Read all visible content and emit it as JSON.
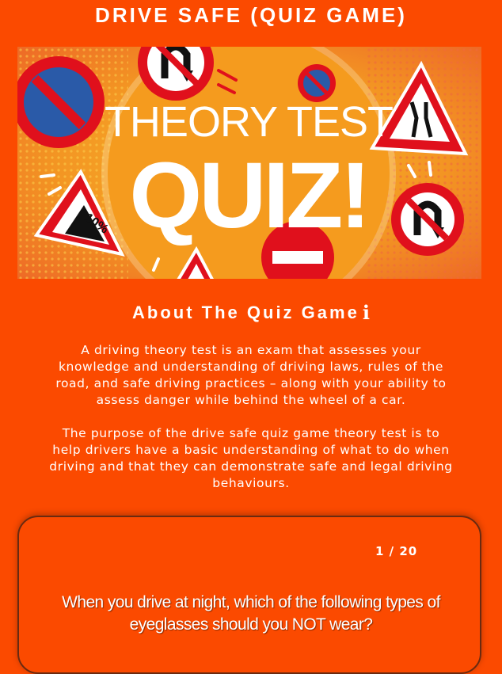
{
  "page": {
    "title": "DRIVE SAFE (QUIZ GAME)",
    "banner": {
      "line1": "THEORY TEST",
      "line2": "QUIZ!",
      "sign_text": "10%"
    }
  },
  "about": {
    "heading": "About The Quiz Game",
    "info_icon": "i",
    "paragraph1": "A driving theory test is an exam that assesses your knowledge and understanding of driving laws, rules of the road, and safe driving practices – along with your ability to assess danger while behind the wheel of a car.",
    "paragraph2": "The purpose of the drive safe quiz game theory test is to help drivers have a basic understanding of what to do when driving and that they can demonstrate safe and legal driving behaviours."
  },
  "quiz": {
    "counter": "1 / 20",
    "question": "When you drive at night, which of the following types of eyeglasses should you NOT wear?"
  },
  "colors": {
    "background": "#fb4a00",
    "banner_bg": "#f7a523",
    "sign_red": "#e0101c",
    "sign_blue": "#2a5aa8"
  },
  "icons": [
    "info-icon",
    "no-u-turn-icon",
    "no-parking-icon",
    "no-entry-icon",
    "road-narrows-icon",
    "steep-hill-icon"
  ]
}
